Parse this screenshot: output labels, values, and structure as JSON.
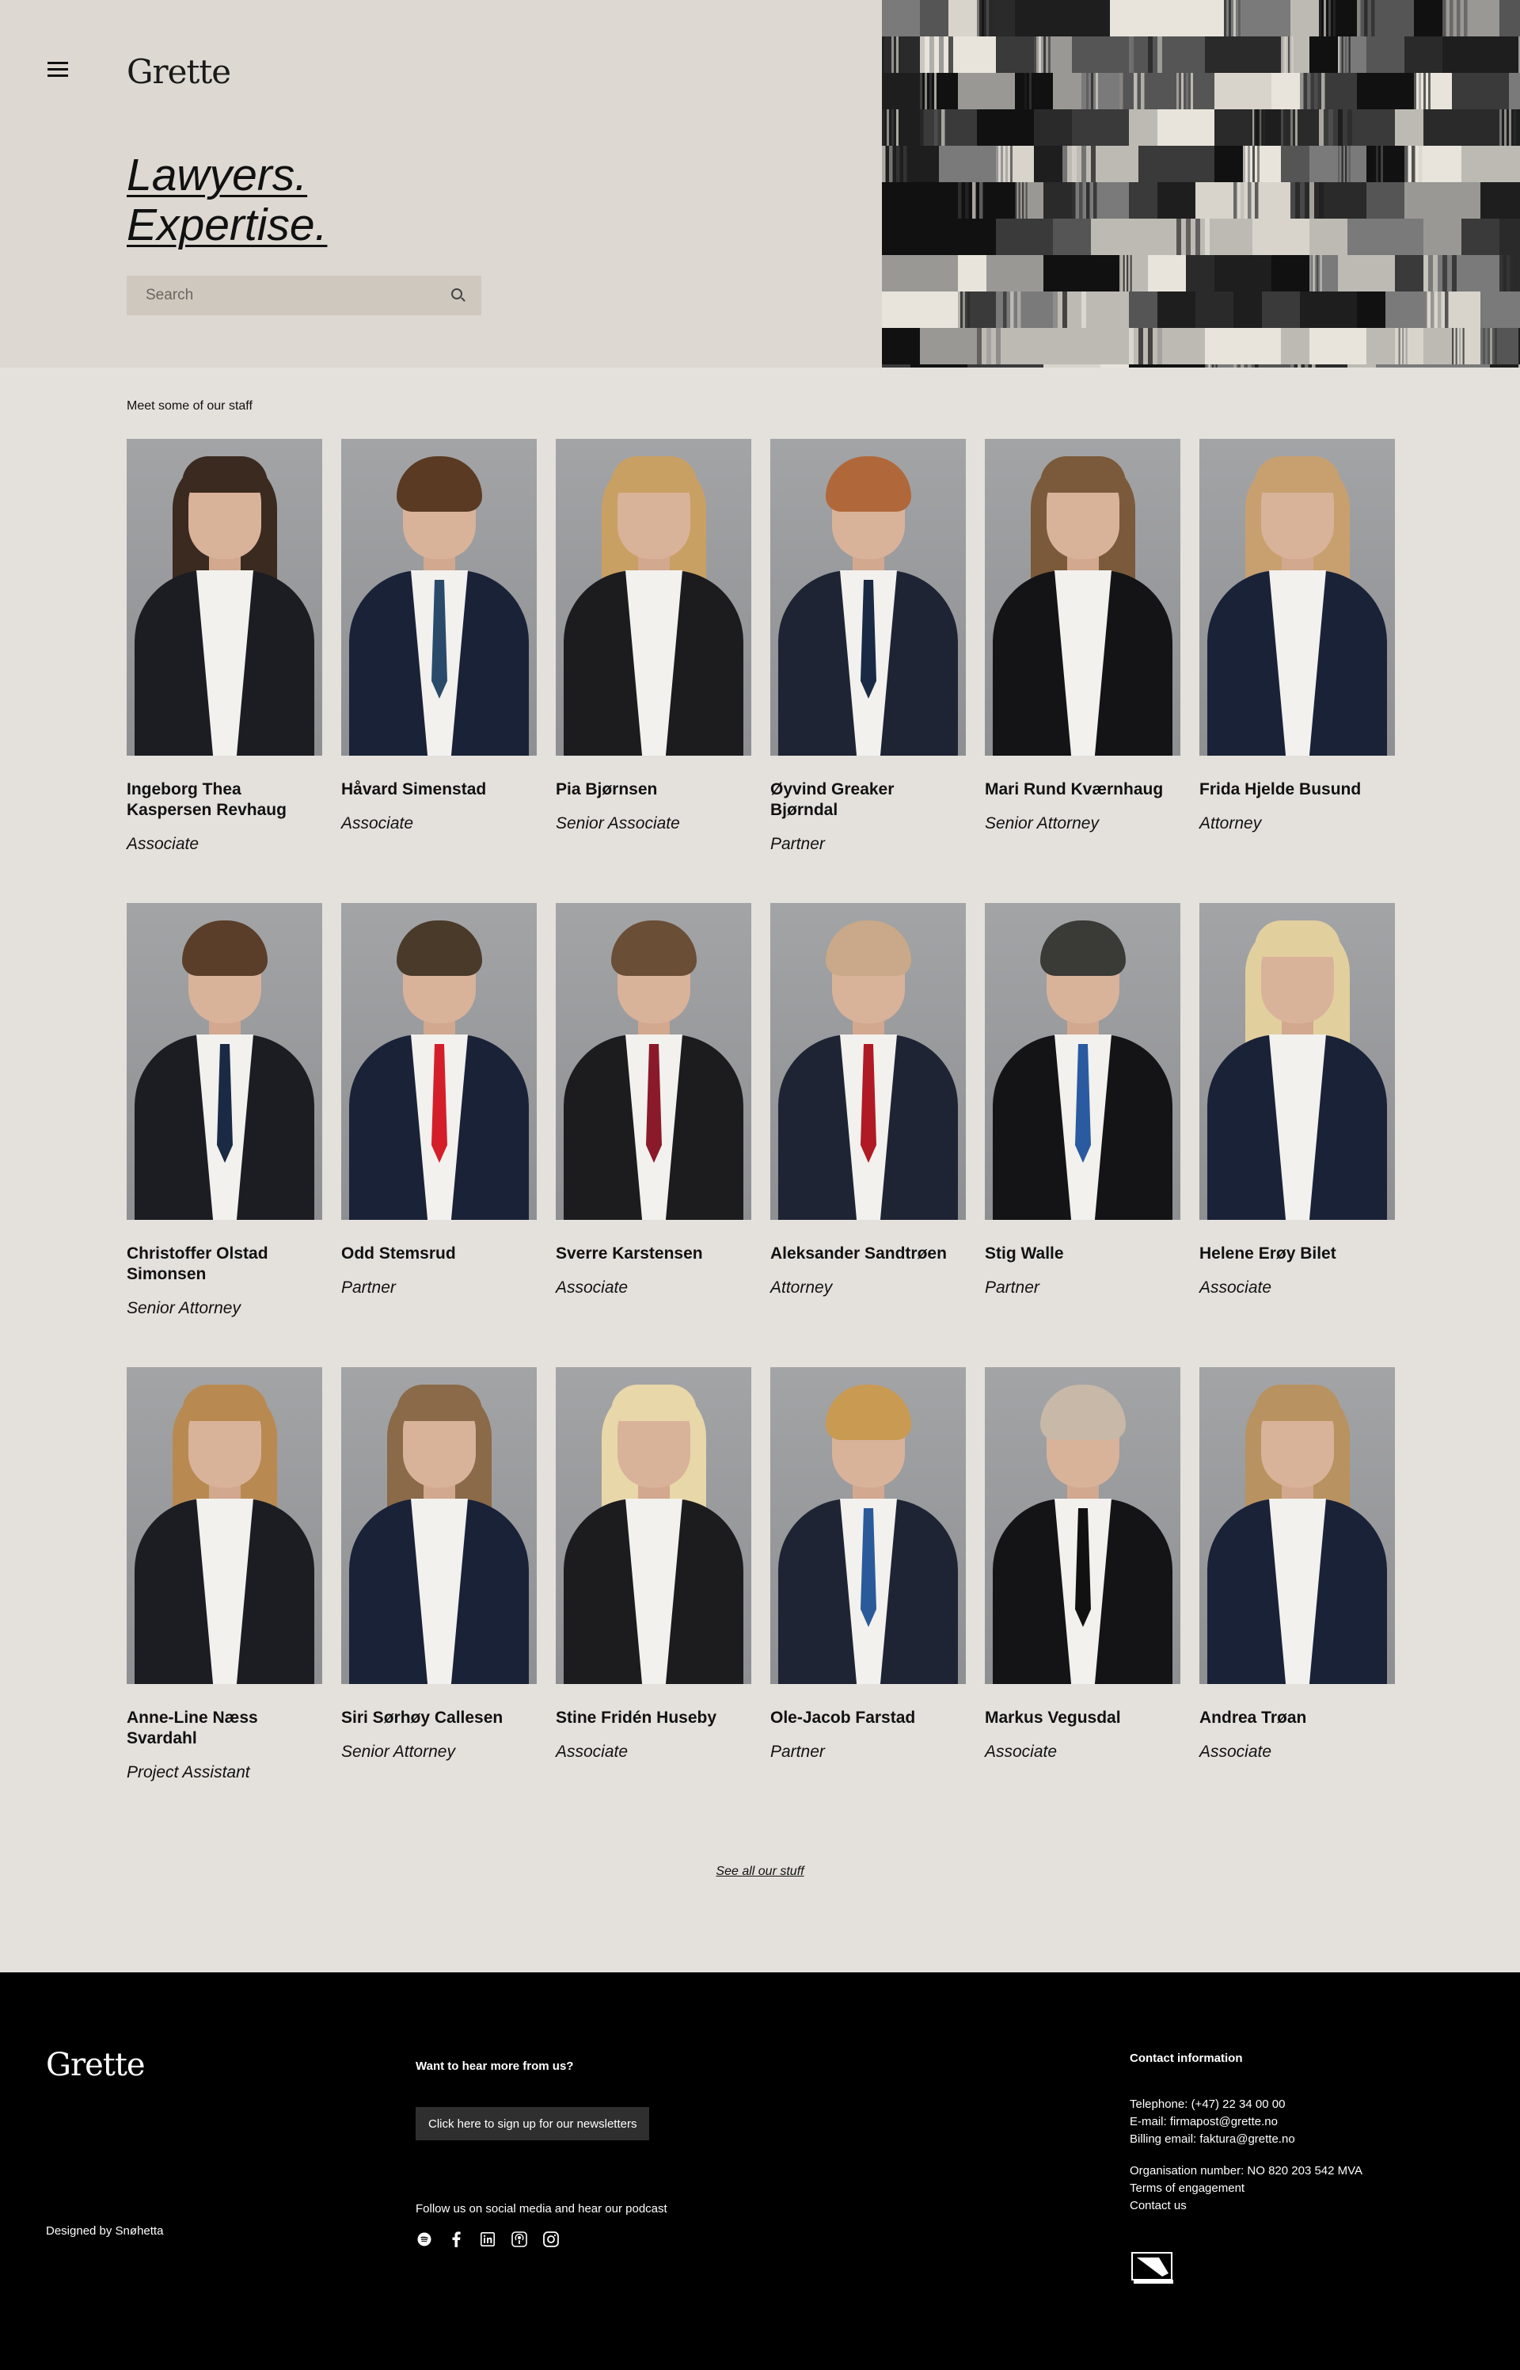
{
  "hero": {
    "logo": "Grette",
    "tagline_line1": "Lawyers.",
    "tagline_line2": "Expertise.",
    "search_placeholder": "Search"
  },
  "staff": {
    "title": "Meet some of our staff",
    "people": [
      {
        "name": "Ingeborg Thea Kaspersen Revhaug",
        "role": "Associate"
      },
      {
        "name": "Håvard Simenstad",
        "role": "Associate"
      },
      {
        "name": "Pia Bjørnsen",
        "role": "Senior Associate"
      },
      {
        "name": "Øyvind Greaker Bjørndal",
        "role": "Partner"
      },
      {
        "name": "Mari Rund Kværnhaug",
        "role": "Senior Attorney"
      },
      {
        "name": "Frida Hjelde Busund",
        "role": "Attorney"
      },
      {
        "name": "Christoffer Olstad Simonsen",
        "role": "Senior Attorney"
      },
      {
        "name": "Odd Stemsrud",
        "role": "Partner"
      },
      {
        "name": "Sverre Karstensen",
        "role": "Associate"
      },
      {
        "name": "Aleksander Sandtrøen",
        "role": "Attorney"
      },
      {
        "name": "Stig Walle",
        "role": "Partner"
      },
      {
        "name": "Helene Erøy Bilet",
        "role": "Associate"
      },
      {
        "name": "Anne-Line Næss Svardahl",
        "role": "Project Assistant"
      },
      {
        "name": "Siri Sørhøy Callesen",
        "role": "Senior Attorney"
      },
      {
        "name": "Stine Fridén Huseby",
        "role": "Associate"
      },
      {
        "name": "Ole-Jacob Farstad",
        "role": "Partner"
      },
      {
        "name": "Markus Vegusdal",
        "role": "Associate"
      },
      {
        "name": "Andrea Trøan",
        "role": "Associate"
      }
    ],
    "see_all": "See all our stuff"
  },
  "footer": {
    "logo": "Grette",
    "designed_by": "Designed by Snøhetta",
    "want_more": "Want to hear more from us?",
    "newsletter_button": "Click here to sign up for our newsletters",
    "follow": "Follow us on social media and hear our podcast",
    "social_icons": [
      "spotify-icon",
      "facebook-icon",
      "linkedin-icon",
      "podcast-icon",
      "instagram-icon"
    ],
    "contact_title": "Contact information",
    "telephone": "Telephone: (+47) 22 34 00 00",
    "email": "E-mail: firmapost@grette.no",
    "billing": "Billing email: faktura@grette.no",
    "org_number": "Organisation number: NO 820 203 542 MVA",
    "terms": "Terms of engagement",
    "contact_us": "Contact us"
  }
}
